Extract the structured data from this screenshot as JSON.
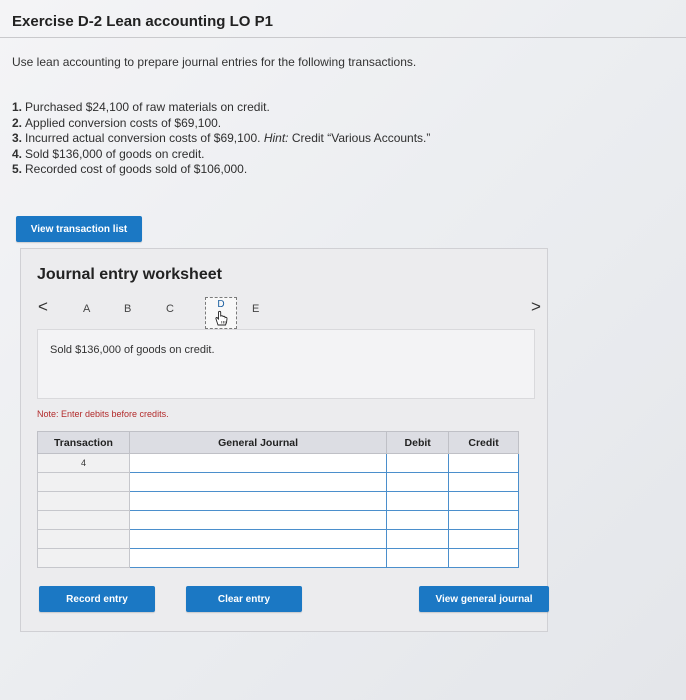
{
  "header": {
    "title": "Exercise D-2 Lean accounting LO P1"
  },
  "instructions": "Use lean accounting to prepare journal entries for the following transactions.",
  "transactions": [
    {
      "num": "1.",
      "text": "Purchased $24,100 of raw materials on credit."
    },
    {
      "num": "2.",
      "text": "Applied conversion costs of $69,100."
    },
    {
      "num": "3.",
      "text": "Incurred actual conversion costs of $69,100.",
      "hint_label": "Hint:",
      "hint_text": "Credit “Various Accounts.”"
    },
    {
      "num": "4.",
      "text": "Sold $136,000 of goods on credit."
    },
    {
      "num": "5.",
      "text": "Recorded cost of goods sold of $106,000."
    }
  ],
  "buttons": {
    "view_transaction_list": "View transaction list",
    "record_entry": "Record entry",
    "clear_entry": "Clear entry",
    "view_general_journal": "View general journal"
  },
  "worksheet": {
    "title": "Journal entry worksheet",
    "nav": {
      "prev": "<",
      "next": ">"
    },
    "steps": [
      "A",
      "B",
      "C",
      "D",
      "E"
    ],
    "current_step": "D",
    "description": "Sold $136,000 of goods on credit.",
    "note": "Note: Enter debits before credits."
  },
  "journal_table": {
    "headers": {
      "transaction": "Transaction",
      "general_journal": "General Journal",
      "debit": "Debit",
      "credit": "Credit"
    },
    "rows": [
      {
        "transaction": "4",
        "account": "",
        "debit": "",
        "credit": ""
      },
      {
        "transaction": "",
        "account": "",
        "debit": "",
        "credit": ""
      },
      {
        "transaction": "",
        "account": "",
        "debit": "",
        "credit": ""
      },
      {
        "transaction": "",
        "account": "",
        "debit": "",
        "credit": ""
      },
      {
        "transaction": "",
        "account": "",
        "debit": "",
        "credit": ""
      },
      {
        "transaction": "",
        "account": "",
        "debit": "",
        "credit": ""
      }
    ]
  },
  "colors": {
    "button_blue": "#1b78c4",
    "note_red": "#b22b2b",
    "input_border": "#4b8fcc"
  },
  "icons": {
    "pointer": "hand-pointer-icon"
  }
}
